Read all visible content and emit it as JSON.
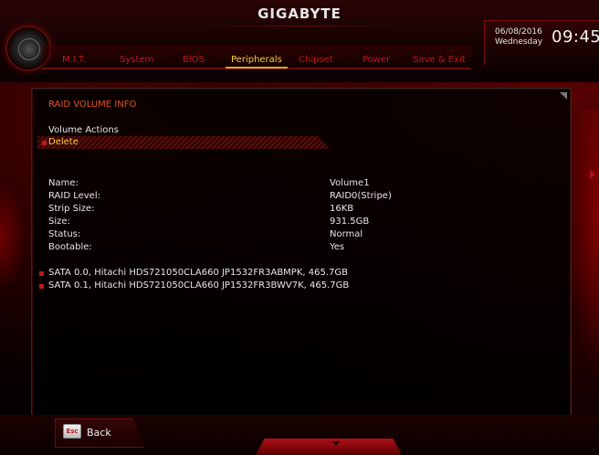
{
  "header": {
    "brand": "GIGABYTE",
    "date": "06/08/2016",
    "day": "Wednesday",
    "time": "09:45"
  },
  "tabs": [
    {
      "label": "M.I.T.",
      "active": false
    },
    {
      "label": "System",
      "active": false
    },
    {
      "label": "BIOS",
      "active": false
    },
    {
      "label": "Peripherals",
      "active": true
    },
    {
      "label": "Chipset",
      "active": false
    },
    {
      "label": "Power",
      "active": false
    },
    {
      "label": "Save & Exit",
      "active": false
    }
  ],
  "main": {
    "section_title": "RAID VOLUME INFO",
    "volume_actions_label": "Volume Actions",
    "delete_label": "Delete",
    "properties": [
      {
        "label": "Name:",
        "value": "Volume1"
      },
      {
        "label": "RAID Level:",
        "value": "RAID0(Stripe)"
      },
      {
        "label": "Strip Size:",
        "value": "16KB"
      },
      {
        "label": "Size:",
        "value": "931.5GB"
      },
      {
        "label": "Status:",
        "value": "Normal"
      },
      {
        "label": "Bootable:",
        "value": "Yes"
      }
    ],
    "disks": [
      "SATA 0.0, Hitachi HDS721050CLA660 JP1532FR3ABMPK, 465.7GB",
      "SATA 0.1, Hitachi HDS721050CLA660 JP1532FR3BWV7K, 465.7GB"
    ]
  },
  "footer": {
    "esc_key": "Esc",
    "back_label": "Back"
  },
  "colors": {
    "accent_red": "#c0181c",
    "active_tab": "#ffcc33",
    "section_title": "#e3541e"
  },
  "icons": {
    "logo_badge": "gigabyte-badge-icon",
    "esc_key": "esc-key-icon"
  }
}
